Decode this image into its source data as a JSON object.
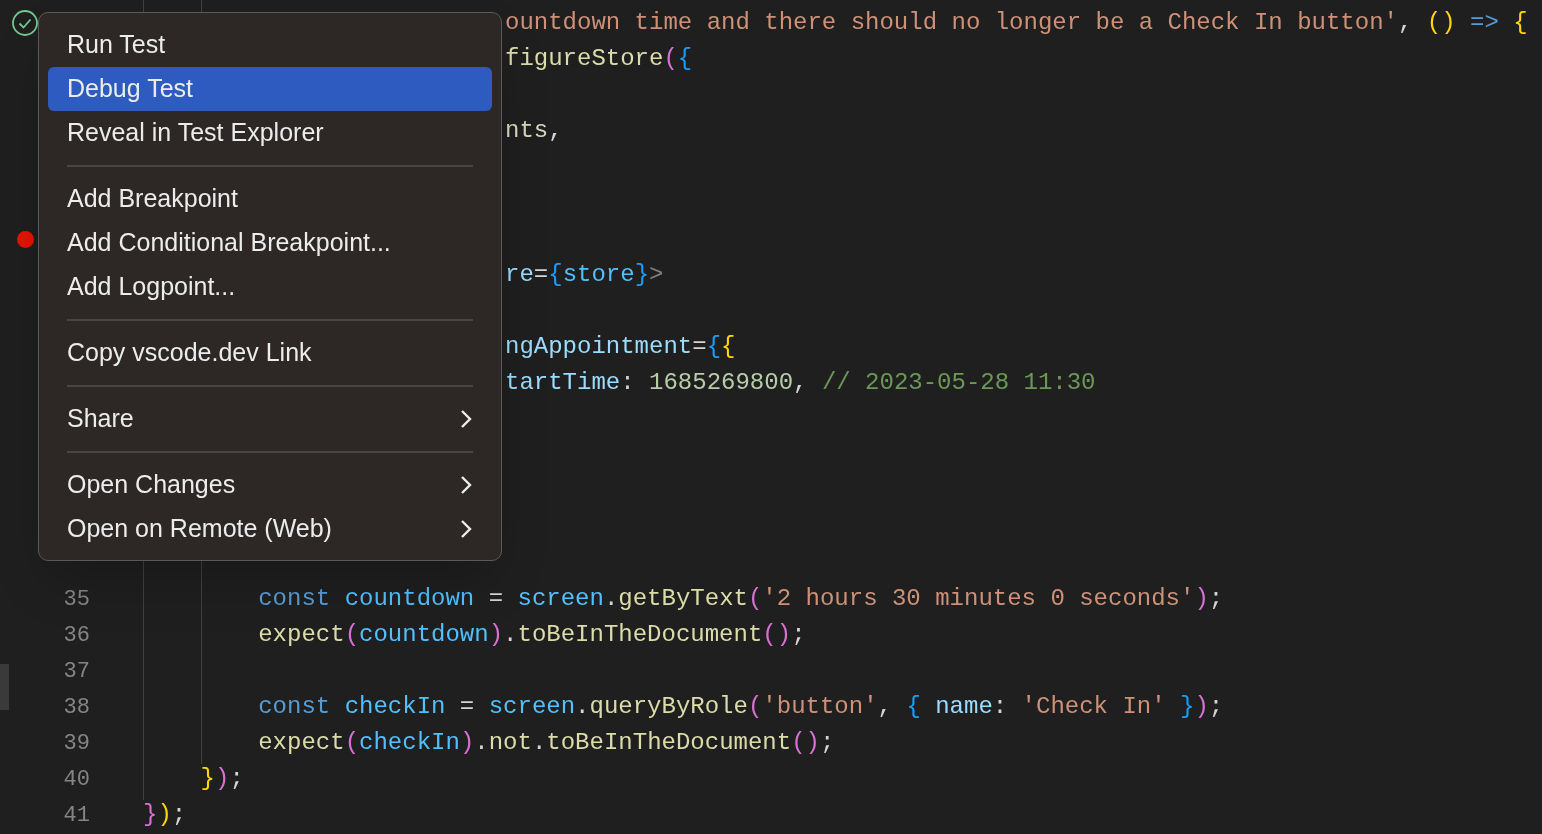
{
  "editor": {
    "rows": [
      {
        "test_passed": true,
        "clipped": true,
        "tokens": [
          {
            "text": "ountdown time and there should no longer be a Check In button'",
            "kind": "string"
          },
          {
            "text": ", ",
            "kind": "plain"
          },
          {
            "text": "()",
            "kind": "bracket1"
          },
          {
            "text": " =>",
            "kind": "keyword"
          },
          {
            "text": " {",
            "kind": "bracket1"
          }
        ]
      },
      {
        "clipped": true,
        "tokens": [
          {
            "text": "figureStore",
            "kind": "function"
          },
          {
            "text": "(",
            "kind": "bracket2"
          },
          {
            "text": "{",
            "kind": "bracket3"
          }
        ]
      },
      {
        "tokens": []
      },
      {
        "clipped": true,
        "tokens": [
          {
            "text": "nts",
            "kind": "variable"
          },
          {
            "text": ",",
            "kind": "plain"
          }
        ]
      },
      {
        "tokens": []
      },
      {
        "tokens": []
      },
      {
        "breakpoint": true,
        "tokens": []
      },
      {
        "clipped": true,
        "tokens": [
          {
            "text": "re",
            "kind": "property"
          },
          {
            "text": "=",
            "kind": "plain"
          },
          {
            "text": "{",
            "kind": "bracket3"
          },
          {
            "text": "store",
            "kind": "constant"
          },
          {
            "text": "}",
            "kind": "bracket3"
          },
          {
            "text": ">",
            "kind": "tag"
          }
        ]
      },
      {
        "tokens": []
      },
      {
        "clipped": true,
        "tokens": [
          {
            "text": "ngAppointment",
            "kind": "property"
          },
          {
            "text": "=",
            "kind": "plain"
          },
          {
            "text": "{",
            "kind": "bracket3"
          },
          {
            "text": "{",
            "kind": "bracket1"
          }
        ]
      },
      {
        "clipped": true,
        "tokens": [
          {
            "text": "tartTime",
            "kind": "property"
          },
          {
            "text": ": ",
            "kind": "plain"
          },
          {
            "text": "1685269800",
            "kind": "number"
          },
          {
            "text": ", ",
            "kind": "plain"
          },
          {
            "text": "// 2023-05-28 11:30",
            "kind": "comment"
          }
        ]
      },
      {
        "tokens": []
      },
      {
        "tokens": []
      },
      {
        "tokens": []
      },
      {
        "tokens": []
      },
      {
        "tokens": []
      },
      {
        "number": "35",
        "tokens": [
          {
            "text": "        const",
            "kind": "keyword"
          },
          {
            "text": " countdown",
            "kind": "constant"
          },
          {
            "text": " = ",
            "kind": "plain"
          },
          {
            "text": "screen",
            "kind": "constant"
          },
          {
            "text": ".",
            "kind": "plain"
          },
          {
            "text": "getByText",
            "kind": "function"
          },
          {
            "text": "(",
            "kind": "bracket2"
          },
          {
            "text": "'2 hours 30 minutes 0 seconds'",
            "kind": "string"
          },
          {
            "text": ")",
            "kind": "bracket2"
          },
          {
            "text": ";",
            "kind": "plain"
          }
        ]
      },
      {
        "number": "36",
        "tokens": [
          {
            "text": "        expect",
            "kind": "function"
          },
          {
            "text": "(",
            "kind": "bracket2"
          },
          {
            "text": "countdown",
            "kind": "constant"
          },
          {
            "text": ")",
            "kind": "bracket2"
          },
          {
            "text": ".",
            "kind": "plain"
          },
          {
            "text": "toBeInTheDocument",
            "kind": "function"
          },
          {
            "text": "()",
            "kind": "bracket2"
          },
          {
            "text": ";",
            "kind": "plain"
          }
        ]
      },
      {
        "number": "37",
        "tokens": []
      },
      {
        "number": "38",
        "tokens": [
          {
            "text": "        const",
            "kind": "keyword"
          },
          {
            "text": " checkIn",
            "kind": "constant"
          },
          {
            "text": " = ",
            "kind": "plain"
          },
          {
            "text": "screen",
            "kind": "constant"
          },
          {
            "text": ".",
            "kind": "plain"
          },
          {
            "text": "queryByRole",
            "kind": "function"
          },
          {
            "text": "(",
            "kind": "bracket2"
          },
          {
            "text": "'button'",
            "kind": "string"
          },
          {
            "text": ", ",
            "kind": "plain"
          },
          {
            "text": "{",
            "kind": "bracket3"
          },
          {
            "text": " name",
            "kind": "property"
          },
          {
            "text": ": ",
            "kind": "plain"
          },
          {
            "text": "'Check In'",
            "kind": "string"
          },
          {
            "text": " }",
            "kind": "bracket3"
          },
          {
            "text": ")",
            "kind": "bracket2"
          },
          {
            "text": ";",
            "kind": "plain"
          }
        ]
      },
      {
        "number": "39",
        "tokens": [
          {
            "text": "        expect",
            "kind": "function"
          },
          {
            "text": "(",
            "kind": "bracket2"
          },
          {
            "text": "checkIn",
            "kind": "constant"
          },
          {
            "text": ")",
            "kind": "bracket2"
          },
          {
            "text": ".",
            "kind": "plain"
          },
          {
            "text": "not",
            "kind": "function"
          },
          {
            "text": ".",
            "kind": "plain"
          },
          {
            "text": "toBeInTheDocument",
            "kind": "function"
          },
          {
            "text": "()",
            "kind": "bracket2"
          },
          {
            "text": ";",
            "kind": "plain"
          }
        ]
      },
      {
        "number": "40",
        "tokens": [
          {
            "text": "    }",
            "kind": "bracket1"
          },
          {
            "text": ")",
            "kind": "bracket2"
          },
          {
            "text": ";",
            "kind": "plain"
          }
        ]
      },
      {
        "number": "41",
        "tokens": [
          {
            "text": "}",
            "kind": "bracket2"
          },
          {
            "text": ")",
            "kind": "bracket1"
          },
          {
            "text": ";",
            "kind": "plain"
          }
        ]
      }
    ]
  },
  "context_menu": {
    "groups": [
      [
        {
          "label": "Run Test",
          "selected": false,
          "submenu": false
        },
        {
          "label": "Debug Test",
          "selected": true,
          "submenu": false
        },
        {
          "label": "Reveal in Test Explorer",
          "selected": false,
          "submenu": false
        }
      ],
      [
        {
          "label": "Add Breakpoint",
          "selected": false,
          "submenu": false
        },
        {
          "label": "Add Conditional Breakpoint...",
          "selected": false,
          "submenu": false
        },
        {
          "label": "Add Logpoint...",
          "selected": false,
          "submenu": false
        }
      ],
      [
        {
          "label": "Copy vscode.dev Link",
          "selected": false,
          "submenu": false
        }
      ],
      [
        {
          "label": "Share",
          "selected": false,
          "submenu": true
        }
      ],
      [
        {
          "label": "Open Changes",
          "selected": false,
          "submenu": true
        },
        {
          "label": "Open on Remote (Web)",
          "selected": false,
          "submenu": true
        }
      ]
    ]
  }
}
